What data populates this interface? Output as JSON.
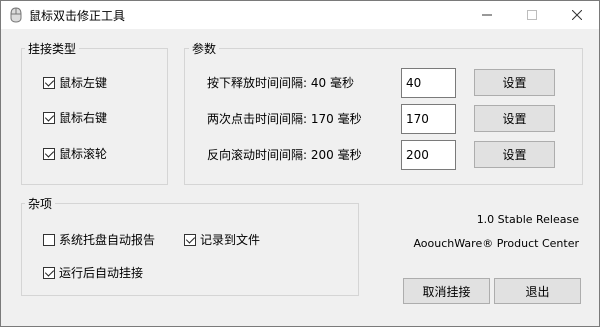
{
  "window": {
    "title": "鼠标双击修正工具",
    "controls": [
      "minimize-icon",
      "maximize-icon",
      "close-icon"
    ]
  },
  "hook_type": {
    "title": "挂接类型",
    "items": [
      {
        "label": "鼠标左键",
        "checked": true
      },
      {
        "label": "鼠标右键",
        "checked": true
      },
      {
        "label": "鼠标滚轮",
        "checked": true
      }
    ]
  },
  "params": {
    "title": "参数",
    "rows": [
      {
        "label": "按下释放时间间隔: 40 毫秒",
        "value": "40",
        "button": "设置"
      },
      {
        "label": "两次点击时间间隔: 170 毫秒",
        "value": "170",
        "button": "设置"
      },
      {
        "label": "反向滚动时间间隔: 200 毫秒",
        "value": "200",
        "button": "设置"
      }
    ]
  },
  "misc": {
    "title": "杂项",
    "tray_report": {
      "label": "系统托盘自动报告",
      "checked": false
    },
    "log_to_file": {
      "label": "记录到文件",
      "checked": true
    },
    "auto_hook": {
      "label": "运行后自动挂接",
      "checked": true
    }
  },
  "info": {
    "version": "1.0 Stable Release",
    "product": "AoouchWare® Product Center"
  },
  "actions": {
    "unhook": "取消挂接",
    "exit": "退出"
  }
}
